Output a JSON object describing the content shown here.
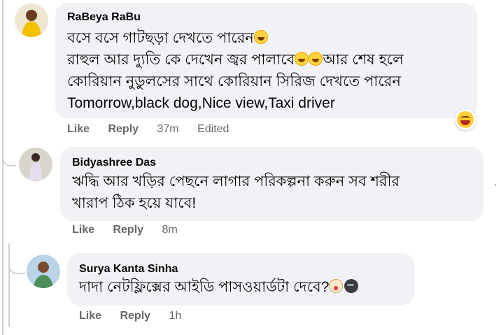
{
  "comments": [
    {
      "author": "RaBeya RaBu",
      "lines": [
        "বসে বসে গাটছড়া দেখতে পারেন",
        "রাহুল আর দ্যুতি কে দেখেন জ্বর পালাবে",
        "আর শেষ হলে",
        "কোরিয়ান নুডুলসের সাথে কোরিয়ান সিরিজ দেখতে পারেন",
        "Tomorrow,black dog,Nice view,Taxi driver"
      ],
      "like_label": "Like",
      "reply_label": "Reply",
      "time": "37m",
      "edited": "Edited",
      "reaction": "laughing-reaction"
    },
    {
      "author": "Bidyashree Das",
      "lines": [
        "ঋদ্ধি আর খড়ির পেছনে লাগার পরিকল্পনা করুন সব শরীর",
        "খারাপ ঠিক হয়ে যাবে!"
      ],
      "like_label": "Like",
      "reply_label": "Reply",
      "time": "8m"
    },
    {
      "author": "Surya Kanta Sinha",
      "lines": [
        "দাদা নেটফ্লিক্সের আইডি পাসওয়ার্ডটা দেবে?"
      ],
      "like_label": "Like",
      "reply_label": "Reply",
      "time": "1h"
    }
  ],
  "colors": {
    "bubble": "#f0f2f5",
    "action_text": "#65676b",
    "thread_line": "#ced0d4"
  }
}
